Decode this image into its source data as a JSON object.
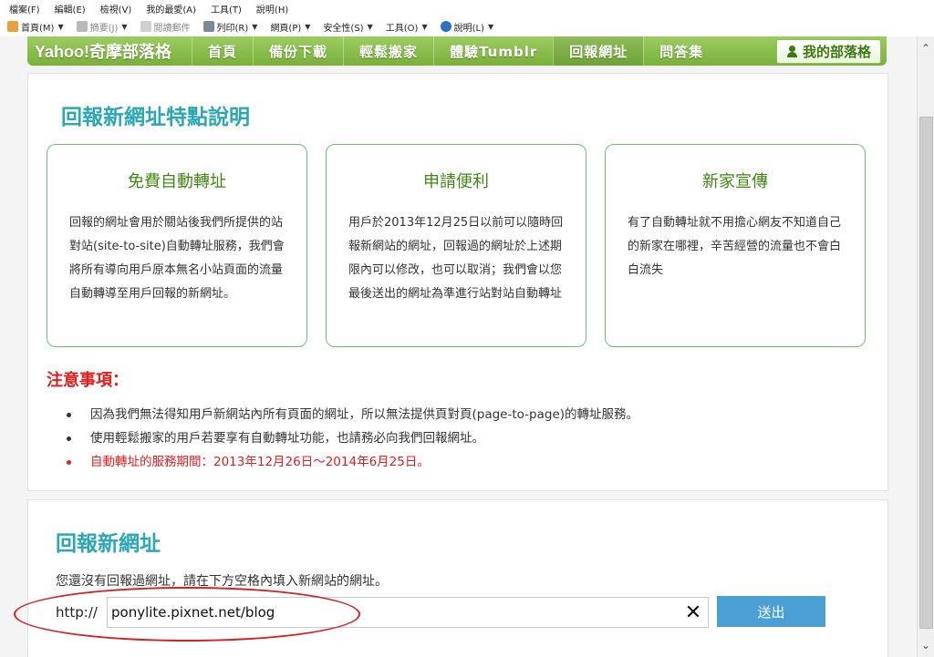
{
  "menu": {
    "items": [
      "檔案(F)",
      "編輯(E)",
      "檢視(V)",
      "我的最愛(A)",
      "工具(T)",
      "說明(H)"
    ]
  },
  "commandbar": {
    "items": [
      {
        "label": "首頁(M)",
        "icon": "home-icon",
        "caret": true
      },
      {
        "label": "摘要(J)",
        "icon": "feed-icon",
        "caret": true,
        "dim": true
      },
      {
        "label": "閱讀郵件",
        "icon": "mail-icon",
        "caret": false
      },
      {
        "label": "列印(R)",
        "icon": "print-icon",
        "caret": true
      },
      {
        "label": "網頁(P)",
        "icon": "",
        "caret": true
      },
      {
        "label": "安全性(S)",
        "icon": "",
        "caret": true
      },
      {
        "label": "工具(O)",
        "icon": "",
        "caret": true
      },
      {
        "label": "說明(L)",
        "icon": "help-icon",
        "caret": true
      }
    ]
  },
  "nav": {
    "brand": "Yahoo!奇摩部落格",
    "items": [
      "首頁",
      "備份下載",
      "輕鬆搬家",
      "體驗Tumblr",
      "回報網址",
      "問答集"
    ],
    "active": "回報網址",
    "my_blog": "我的部落格"
  },
  "features": {
    "title": "回報新網址特點說明",
    "cards": [
      {
        "title": "免費自動轉址",
        "body": "回報的網址會用於關站後我們所提供的站對站(site-to-site)自動轉址服務，我們會將所有導向用戶原本無名小站頁面的流量自動轉導至用戶回報的新網址。"
      },
      {
        "title": "申請便利",
        "body": "用戶於2013年12月25日以前可以隨時回報新網站的網址，回報過的網址於上述期限內可以修改，也可以取消；我們會以您最後送出的網址為準進行站對站自動轉址"
      },
      {
        "title": "新家宣傳",
        "body": "有了自動轉址就不用擔心網友不知道自己的新家在哪裡，辛苦經營的流量也不會白白流失"
      }
    ]
  },
  "notice": {
    "title": "注意事項：",
    "items": [
      "因為我們無法得知用戶新網站內所有頁面的網址，所以無法提供頁對頁(page-to-page)的轉址服務。",
      "使用輕鬆搬家的用戶若要享有自動轉址功能，也請務必向我們回報網址。",
      "自動轉址的服務期間：2013年12月26日～2014年6月25日。"
    ]
  },
  "form": {
    "title": "回報新網址",
    "description": "您還沒有回報過網址，請在下方空格內填入新網站的網址。",
    "prefix": "http://",
    "url_value": "ponylite.pixnet.net/blog",
    "clear_symbol": "✕",
    "submit_label": "送出"
  },
  "colors": {
    "nav_green": "#78b13a",
    "title_teal": "#2aa7b5",
    "card_title_green": "#3d8a12",
    "notice_red": "#e41e1e",
    "submit_blue": "#4a9fd4",
    "annotation_red": "#d32020"
  }
}
